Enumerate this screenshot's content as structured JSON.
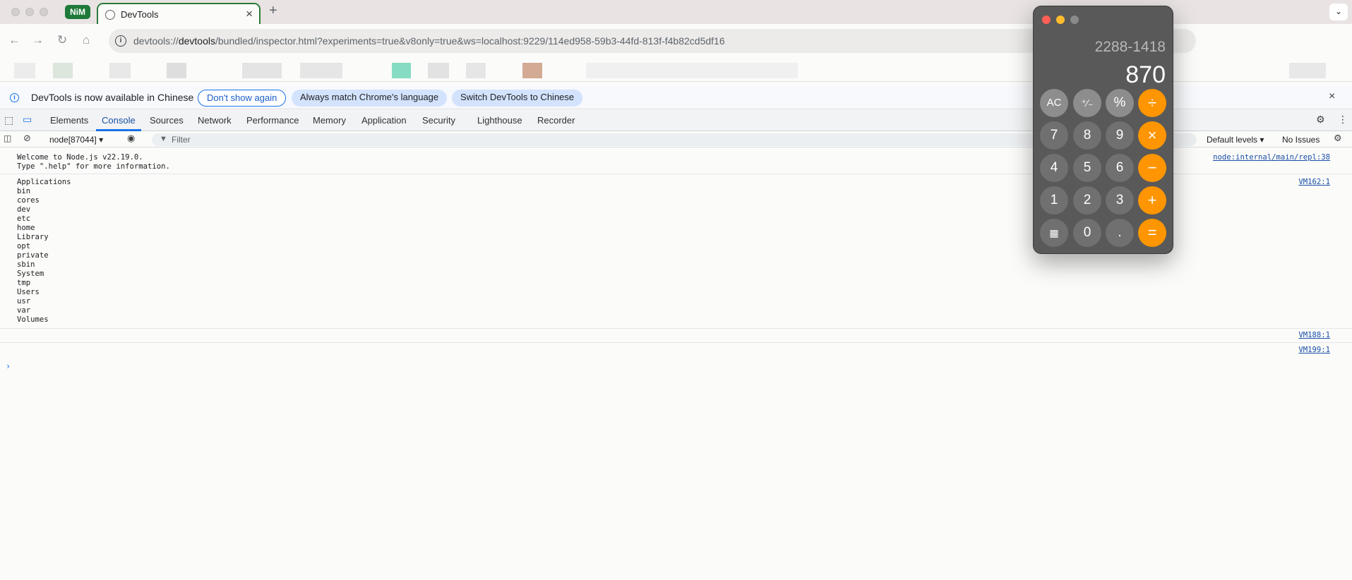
{
  "browser": {
    "badge": "NiM",
    "tab_title": "DevTools",
    "tab_close": "×",
    "new_tab": "+",
    "tab_menu": "⌄",
    "url_prefix": "devtools://",
    "url_host": "devtools",
    "url_path": "/bundled/inspector.html?experiments=true&v8only=true&ws=localhost:9229/114ed958-59b3-44fd-813f-f4b82cd5df16"
  },
  "infobar": {
    "message": "DevTools is now available in Chinese",
    "dont_show": "Don't show again",
    "always_match": "Always match Chrome's language",
    "switch": "Switch DevTools to Chinese",
    "close": "×"
  },
  "devtools": {
    "tabs": [
      "Elements",
      "Console",
      "Sources",
      "Network",
      "Performance",
      "Memory",
      "Application",
      "Security",
      "Lighthouse",
      "Recorder"
    ],
    "active_tab": "Console",
    "context": "node[87044]",
    "filter_placeholder": "Filter",
    "levels": "Default levels",
    "issues": "No Issues"
  },
  "console": {
    "messages": [
      {
        "lines": [
          "Welcome to Node.js v22.19.0.",
          "Type \".help\" for more information."
        ],
        "source": "node:internal/main/repl:38"
      },
      {
        "lines": [
          "Applications",
          "bin",
          "cores",
          "dev",
          "etc",
          "home",
          "Library",
          "opt",
          "private",
          "sbin",
          "System",
          "tmp",
          "Users",
          "usr",
          "var",
          "Volumes"
        ],
        "source": "VM162:1"
      },
      {
        "lines": [],
        "source": "VM188:1"
      },
      {
        "lines": [],
        "source": "VM199:1"
      }
    ],
    "prompt": "›"
  },
  "calculator": {
    "expression": "2288-1418",
    "result": "870",
    "keys": [
      [
        "AC",
        "⁺∕₋",
        "%",
        "÷"
      ],
      [
        "7",
        "8",
        "9",
        "×"
      ],
      [
        "4",
        "5",
        "6",
        "−"
      ],
      [
        "1",
        "2",
        "3",
        "+"
      ],
      [
        "calc-icon",
        "0",
        ".",
        "="
      ]
    ],
    "colors": {
      "operator": "#ff9500",
      "function": "#8d8d8d",
      "digit": "#707070",
      "body": "#595959"
    }
  }
}
